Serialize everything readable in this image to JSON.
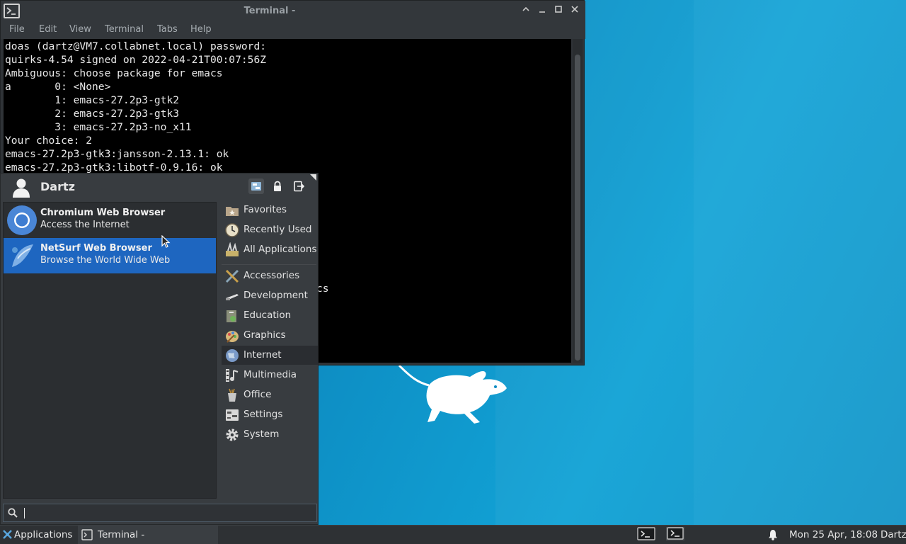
{
  "terminal": {
    "title": "Terminal -",
    "menu": [
      "File",
      "Edit",
      "View",
      "Terminal",
      "Tabs",
      "Help"
    ],
    "lines": [
      "doas (dartz@VM7.collabnet.local) password:",
      "quirks-4.54 signed on 2022-04-21T00:07:56Z",
      "Ambiguous: choose package for emacs",
      "a       0: <None>",
      "        1: emacs-27.2p3-gtk2",
      "        2: emacs-27.2p3-gtk3",
      "        3: emacs-27.2p3-no_x11",
      "Your choice: 2",
      "emacs-27.2p3-gtk3:jansson-2.13.1: ok",
      "emacs-27.2p3-gtk3:libotf-0.9.16: ok"
    ],
    "partial_text": "cs"
  },
  "whisker": {
    "user": "Dartz",
    "favorites": [
      {
        "name": "Chromium Web Browser",
        "desc": "Access the Internet"
      },
      {
        "name": "NetSurf Web Browser",
        "desc": "Browse the World Wide Web"
      }
    ],
    "categories_top": [
      "Favorites",
      "Recently Used",
      "All Applications"
    ],
    "categories": [
      "Accessories",
      "Development",
      "Education",
      "Graphics",
      "Internet",
      "Multimedia",
      "Office",
      "Settings",
      "System"
    ],
    "search_value": ""
  },
  "taskbar": {
    "applications_label": "Applications",
    "task_label": "Terminal -",
    "clock": "Mon 25 Apr, 18:08",
    "user": "Dartz"
  },
  "colors": {
    "selection": "#1e66c0",
    "desktop": "#0d8cc2",
    "panel": "#2e3134"
  }
}
